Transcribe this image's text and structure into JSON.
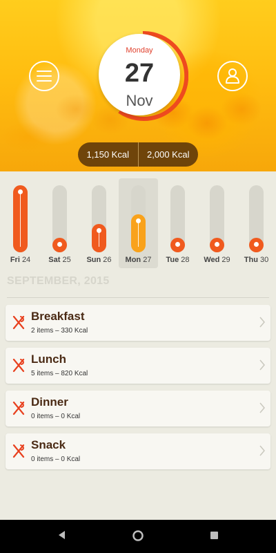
{
  "header": {
    "date": {
      "weekday": "Monday",
      "day": "27",
      "month": "Nov"
    },
    "kcal": {
      "consumed": "1,150 Kcal",
      "goal": "2,000 Kcal"
    },
    "icons": {
      "menu": "hamburger-menu-icon",
      "profile": "user-profile-icon"
    }
  },
  "week": {
    "days": [
      {
        "weekday": "Fri",
        "num": "24",
        "level": 1.0
      },
      {
        "weekday": "Sat",
        "num": "25",
        "level": 0.2
      },
      {
        "weekday": "Sun",
        "num": "26",
        "level": 0.42
      },
      {
        "weekday": "Mon",
        "num": "27",
        "level": 0.57
      },
      {
        "weekday": "Tue",
        "num": "28",
        "level": 0.2
      },
      {
        "weekday": "Wed",
        "num": "29",
        "level": 0.2
      },
      {
        "weekday": "Thu",
        "num": "30",
        "level": 0.2
      }
    ],
    "selected_index": 3
  },
  "month_title": "SEPTEMBER, 2015",
  "meals": [
    {
      "name": "Breakfast",
      "summary": "2 items – 330 Kcal"
    },
    {
      "name": "Lunch",
      "summary": "5 items – 820 Kcal"
    },
    {
      "name": "Dinner",
      "summary": "0 items – 0 Kcal"
    },
    {
      "name": "Snack",
      "summary": "0 items – 0 Kcal"
    }
  ],
  "colors": {
    "accent": "#f05a1e",
    "current": "#f9a21b",
    "header": "#ffbd10",
    "pill": "#50300a"
  },
  "navbar": {
    "icons": [
      "back-icon",
      "home-icon",
      "recents-icon"
    ]
  }
}
